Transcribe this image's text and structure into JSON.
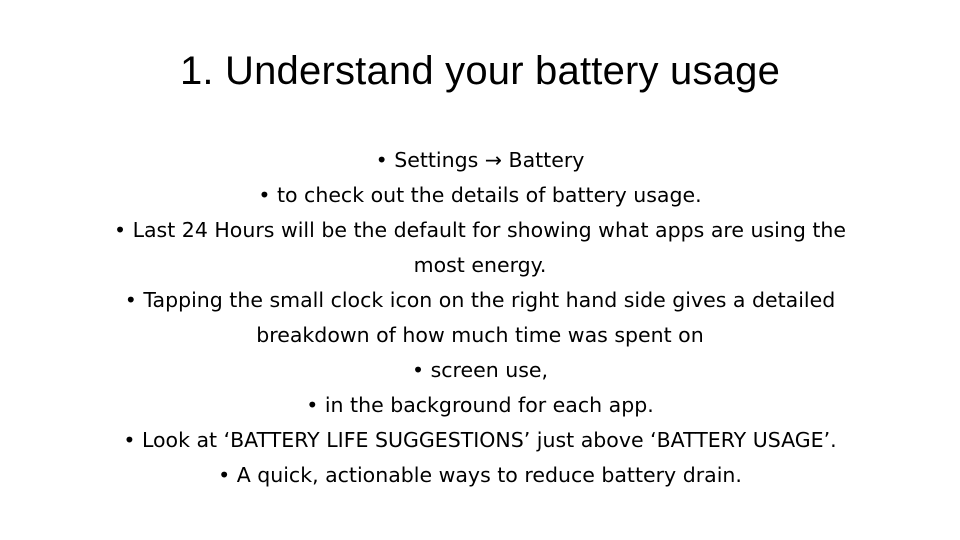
{
  "slide": {
    "title": "1. Understand your battery usage",
    "background_color": "#ffffff",
    "text_color": "#000000",
    "bullet_glyph": "•",
    "body": [
      {
        "level": 1,
        "text": "Settings → Battery"
      },
      {
        "level": 2,
        "text": "to check out the details of battery usage."
      },
      {
        "level": 2,
        "text": "Last 24 Hours will be the default for showing what apps are using the most energy."
      },
      {
        "level": 2,
        "text": "Tapping the small clock icon on the right hand side gives a detailed breakdown of how much time was spent on"
      },
      {
        "level": 3,
        "text": "screen use,"
      },
      {
        "level": 3,
        "text": "in the background for each app."
      },
      {
        "level": 1,
        "text": "Look at ‘BATTERY LIFE SUGGESTIONS’ just above ‘BATTERY USAGE’."
      },
      {
        "level": 2,
        "text": "A quick, actionable ways to reduce battery drain."
      }
    ]
  }
}
